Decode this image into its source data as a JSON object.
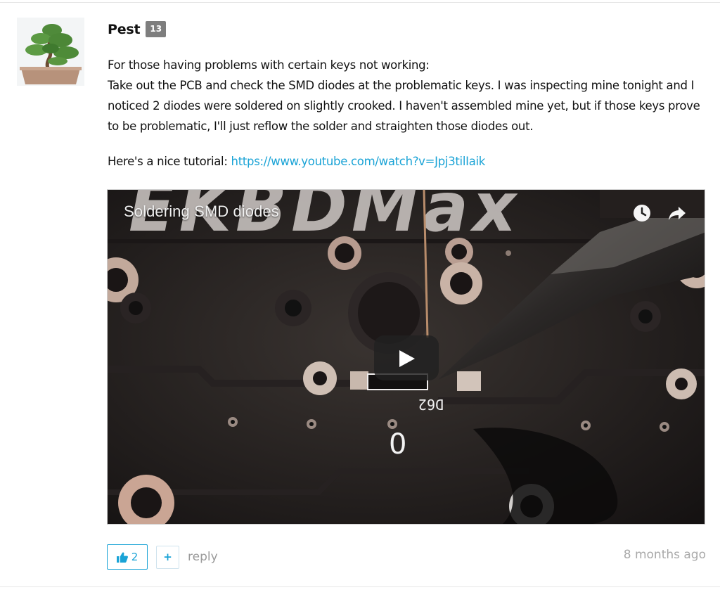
{
  "comment": {
    "username": "Pest",
    "reputation": "13",
    "avatar_icon": "bonsai-tree-avatar",
    "lines": [
      "For those having problems with certain keys not working:",
      "Take out the PCB and check the SMD diodes at the problematic keys. I was inspecting mine tonight and I",
      "noticed 2 diodes were soldered on slightly crooked. I haven't assembled mine yet, but if those keys prove",
      "to be problematic, I'll just reflow the solder and straighten those diodes out."
    ],
    "tutorial_prefix": "Here's a nice tutorial: ",
    "tutorial_link": "https://www.youtube.com/watch?v=Jpj3tilIaik",
    "video": {
      "title": "Soldering SMD diodes",
      "watch_later_icon": "clock-icon",
      "share_icon": "share-arrow-icon",
      "play_icon": "play-icon"
    },
    "votes": "2",
    "plus_label": "+",
    "reply_label": "reply",
    "timestamp": "8 months ago"
  },
  "colors": {
    "accent": "#1aa3d6",
    "badge": "#7e7e7e",
    "muted": "#9a9a9a"
  }
}
